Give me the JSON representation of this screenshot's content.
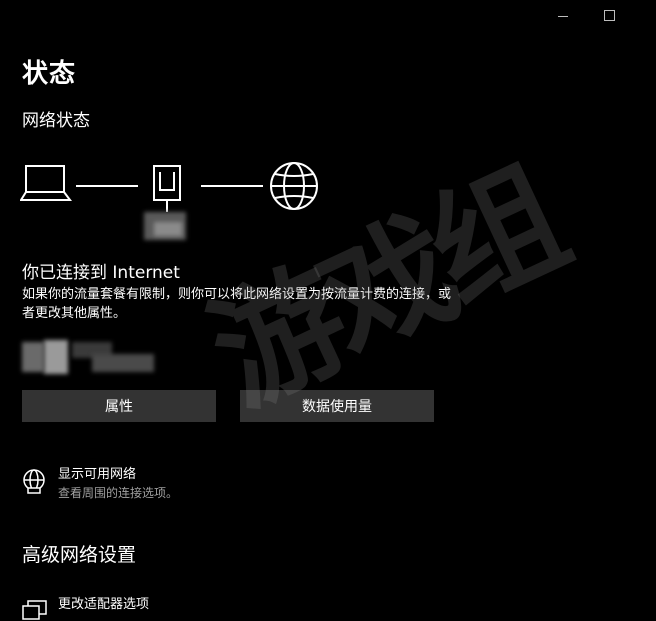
{
  "window": {
    "minimize_icon": "minimize-icon",
    "maximize_icon": "maximize-icon"
  },
  "page": {
    "title": "状态"
  },
  "network_status": {
    "title": "网络状态",
    "icons": [
      "laptop-icon",
      "router-icon",
      "globe-icon"
    ]
  },
  "connection": {
    "title": "你已连接到 Internet",
    "description": "如果你的流量套餐有限制，则你可以将此网络设置为按流量计费的连接，或者更改其他属性。"
  },
  "buttons": {
    "properties": "属性",
    "data_usage": "数据使用量"
  },
  "show_networks": {
    "title": "显示可用网络",
    "subtitle": "查看周围的连接选项。"
  },
  "advanced": {
    "title": "高级网络设置",
    "change_adapter": "更改适配器选项"
  },
  "watermark": {
    "text": "游戏组"
  },
  "colors": {
    "background": "#000000",
    "button": "#333333",
    "text": "#ffffff",
    "subtext": "#a0a0a0"
  }
}
